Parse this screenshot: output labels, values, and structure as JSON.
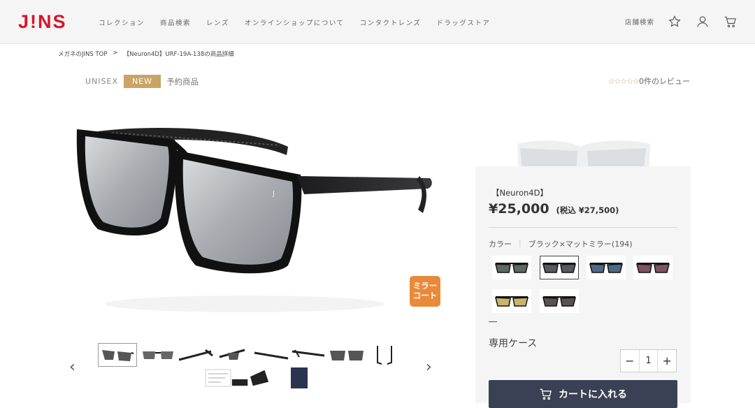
{
  "header": {
    "logo": "J!NS",
    "nav": [
      "コレクション",
      "商品検索",
      "レンズ",
      "オンラインショップについて",
      "コンタクトレンズ",
      "ドラッグストア"
    ],
    "store_search": "店舗検索",
    "icons": [
      "star-icon",
      "user-icon",
      "cart-icon"
    ]
  },
  "breadcrumb": {
    "home": "メガネのJINS TOP",
    "separator": ">",
    "current": "【Neuron4D】URF-19A-138の商品詳細"
  },
  "tags": {
    "gender": "UNISEX",
    "new": "NEW",
    "preorder": "予約商品"
  },
  "review": {
    "stars": "☆☆☆☆☆",
    "text": "0件のレビュー"
  },
  "badge": {
    "line1": "ミラー",
    "line2": "コート"
  },
  "product": {
    "series": "【Neuron4D】",
    "price": "¥25,000",
    "tax_included": "(税込 ¥27,500)",
    "color_label": "カラー",
    "color_value": "ブラック×マットミラー(194)",
    "case_label": "専用ケース",
    "quantity": "1",
    "minus": "−",
    "plus": "+",
    "cart_button": "カートに入れる"
  },
  "colors": {
    "accent_red": "#d9142b",
    "tag_gold": "#c9a464",
    "badge_orange": "#e98a3b",
    "cart_button_bg": "#3a4154"
  },
  "swatch_lens_colors": [
    "#5d6a62",
    "#555a60",
    "#4d6a86",
    "#7c5462",
    "#c9b46a",
    "#5a5250"
  ],
  "arrows": {
    "prev": "‹",
    "next": "›"
  }
}
